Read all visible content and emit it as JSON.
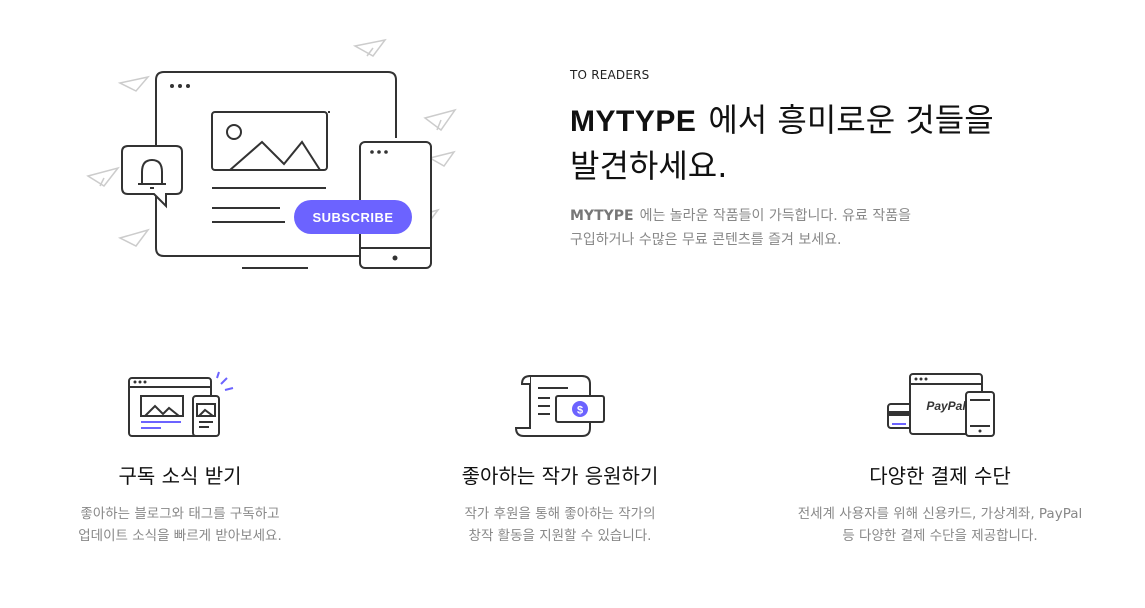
{
  "hero": {
    "eyebrow": "TO READERS",
    "headline_brand": "MYTYPE",
    "headline_rest": "에서 흥미로운 것들을",
    "headline_line2": "발견하세요.",
    "desc_brand": "MYTYPE",
    "desc_line1": "에는 놀라운 작품들이 가득합니다. 유료 작품을",
    "desc_line2": "구입하거나 수많은 무료 콘텐츠를 즐겨 보세요.",
    "subscribe_label": "SUBSCRIBE"
  },
  "features": [
    {
      "title": "구독 소식 받기",
      "line1": "좋아하는 블로그와 태그를 구독하고",
      "line2": "업데이트 소식을 빠르게 받아보세요."
    },
    {
      "title": "좋아하는 작가 응원하기",
      "line1": "작가 후원을 통해 좋아하는 작가의",
      "line2": "창작 활동을 지원할 수 있습니다."
    },
    {
      "title": "다양한 결제 수단",
      "line1": "전세계 사용자를 위해 신용카드, 가상계좌, PayPal",
      "line2": "등 다양한 결제 수단을 제공합니다.",
      "paypal_label": "PayPal",
      "dollar_label": "$"
    }
  ],
  "colors": {
    "accent": "#6c63ff",
    "ink": "#333333",
    "muted": "#888888",
    "paper_plane": "#cccccc"
  }
}
